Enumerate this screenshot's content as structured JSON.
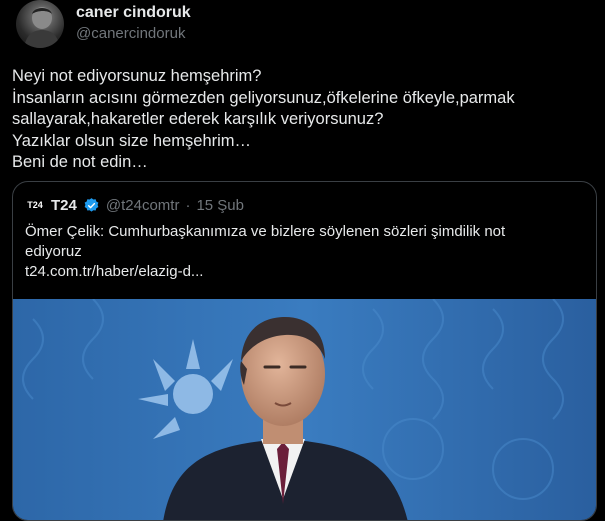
{
  "author": {
    "display_name": "caner cindoruk",
    "handle": "@canercindoruk"
  },
  "tweet": {
    "text": "Neyi not ediyorsunuz hemşehrim?\nİnsanların acısını görmezden geliyorsunuz,öfkelerine öfkeyle,parmak sallayarak,hakaretler ederek karşılık veriyorsunuz?\nYazıklar olsun size hemşehrim…\nBeni de not edin…"
  },
  "quote": {
    "logo_text": "T24",
    "name": "T24",
    "handle": "@t24comtr",
    "separator": "·",
    "date": "15 Şub",
    "text_line1": "Ömer Çelik: Cumhurbaşkanımıza ve bizlere söylenen sözleri şimdilik not",
    "text_line2": "ediyoruz",
    "link": "t24.com.tr/haber/elazig-d...",
    "verified_icon": "verified-badge-icon",
    "image_icon": "press-conference-photo"
  },
  "colors": {
    "background": "#000000",
    "text_primary": "#e7e9ea",
    "text_secondary": "#71767b",
    "verified": "#1d9bf0",
    "photo_backdrop": "#2f6fb3"
  }
}
